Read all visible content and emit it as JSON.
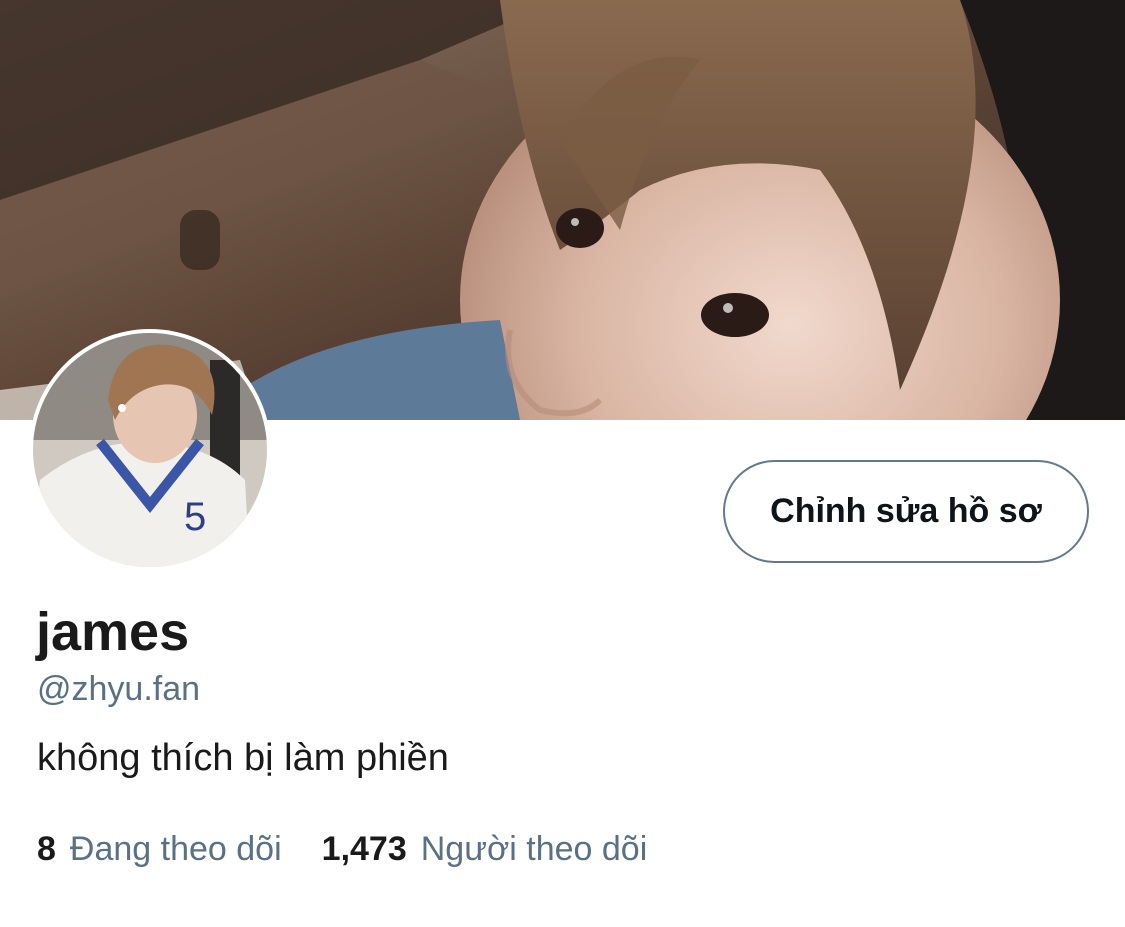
{
  "profile": {
    "display_name": "james",
    "handle": "@zhyu.fan",
    "bio": "không thích bị làm phiền",
    "edit_button_label": "Chỉnh sửa hồ sơ"
  },
  "stats": {
    "following_count": "8",
    "following_label": "Đang theo dõi",
    "followers_count": "1,473",
    "followers_label": "Người theo dõi"
  },
  "images": {
    "banner": "banner-photo",
    "avatar": "avatar-photo"
  },
  "colors": {
    "text_primary": "#1a1a1a",
    "text_secondary": "#5b7083",
    "button_border": "#66798a",
    "background": "#ffffff"
  }
}
